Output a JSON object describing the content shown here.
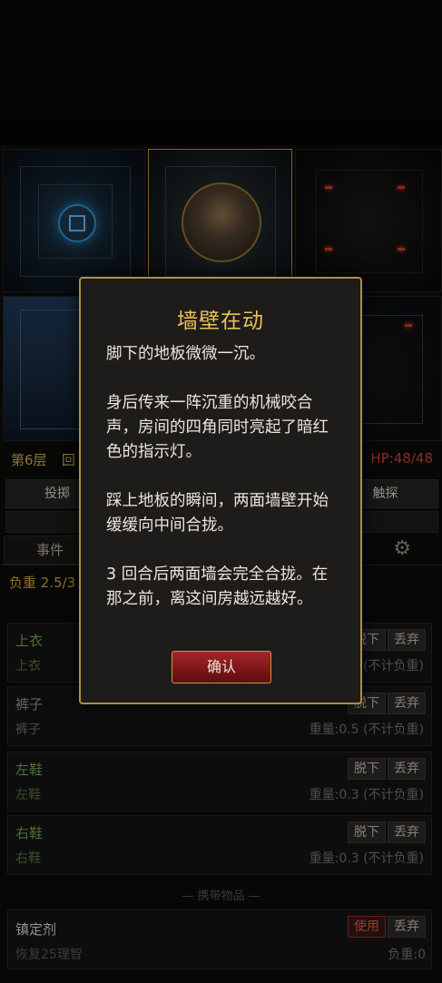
{
  "status": {
    "floor": "第6层",
    "round": "回",
    "hp": "HP:48/48"
  },
  "actions": {
    "roll": "投掷",
    "probe": "触探"
  },
  "tabs": {
    "events": "事件"
  },
  "load": {
    "label": "负重 2.5/3"
  },
  "equipment": [
    {
      "name": "上衣",
      "sub": "上衣",
      "weight": "(不计负重)",
      "unequip": "脱下",
      "drop": "丢弃"
    },
    {
      "name": "裤子",
      "sub": "裤子",
      "weight": "重量:0.5 (不计负重)",
      "unequip": "脱下",
      "drop": "丢弃"
    },
    {
      "name": "左鞋",
      "sub": "左鞋",
      "weight": "重量:0.3 (不计负重)",
      "unequip": "脱下",
      "drop": "丢弃"
    },
    {
      "name": "右鞋",
      "sub": "右鞋",
      "weight": "重量:0.3 (不计负重)",
      "unequip": "脱下",
      "drop": "丢弃"
    }
  ],
  "inventory": {
    "section_title": "— 携带物品 —",
    "items": [
      {
        "name": "镇定剂",
        "desc": "恢复25理智",
        "weight": "负重:0",
        "use": "使用",
        "drop": "丢弃"
      }
    ]
  },
  "modal": {
    "title": "墙壁在动",
    "paragraphs": [
      "脚下的地板微微一沉。",
      "身后传来一阵沉重的机械咬合声，房间的四角同时亮起了暗红色的指示灯。",
      "踩上地板的瞬间，两面墙壁开始缓缓向中间合拢。",
      "3 回合后两面墙会完全合拢。在那之前，离这间房越远越好。"
    ],
    "confirm": "确认"
  },
  "colors": {
    "accent_gold": "#b08f3c",
    "title_gold": "#e8c35a",
    "confirm_red": "#8b1a1f",
    "hp_red": "#b9412f",
    "equip_green": "#6a9a4c"
  },
  "icons": {
    "settings": "gear-icon",
    "portal": "portal-icon"
  }
}
